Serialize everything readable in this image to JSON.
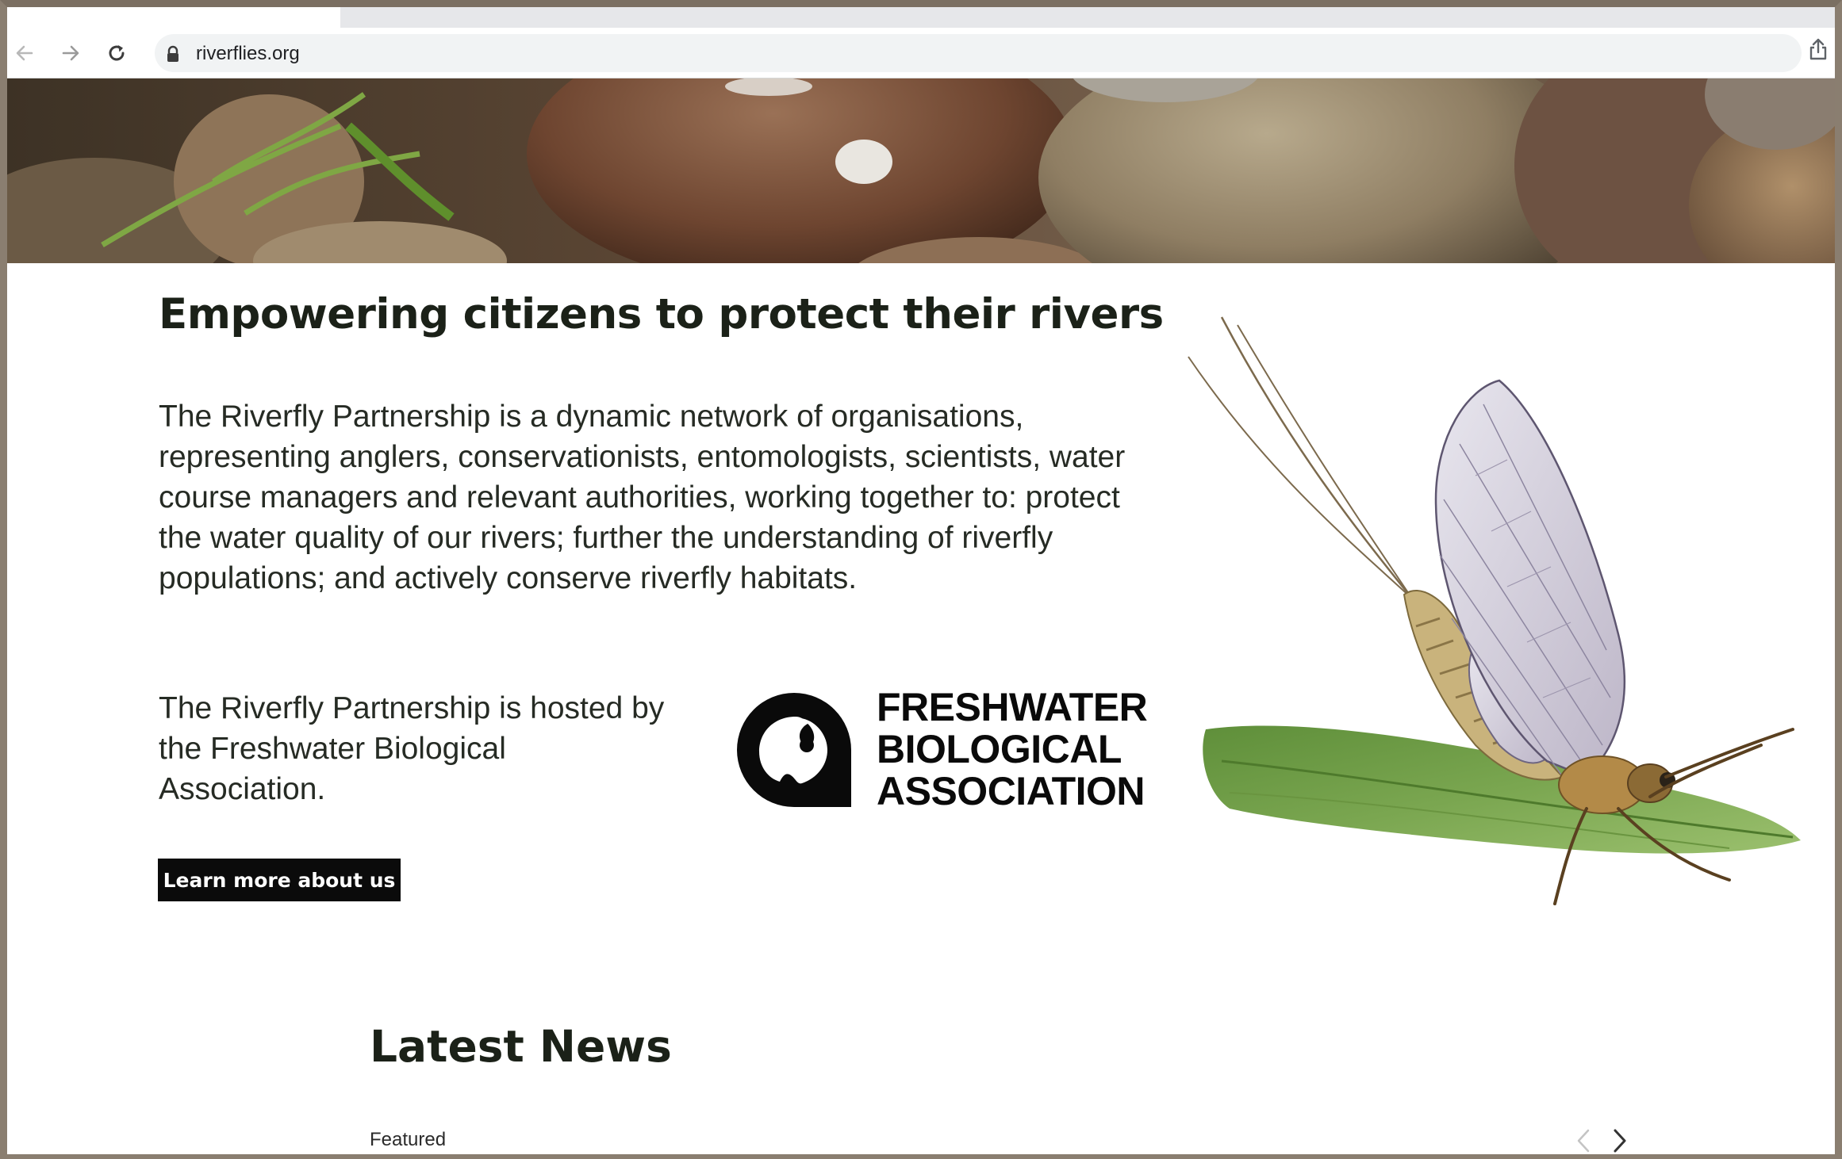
{
  "browser": {
    "url": "riverflies.org",
    "icons": {
      "back": "arrow-left-icon",
      "forward": "arrow-right-icon",
      "reload": "reload-icon",
      "lock": "lock-icon",
      "share": "share-icon"
    }
  },
  "hero": {
    "headline": "Empowering citizens to protect their rivers",
    "intro": "The Riverfly Partnership is a dynamic network of organisations, representing anglers, conservationists, entomologists, scientists, water course managers and relevant authorities, working together to: protect the water quality of our rivers; further the understanding of riverfly populations; and actively conserve riverfly habitats.",
    "hosted": "The Riverfly Partnership is hosted by the Freshwater Biological Association.",
    "cta_label": "Learn more about us"
  },
  "partner_logo": {
    "line1": "FRESHWATER",
    "line2": "BIOLOGICAL",
    "line3": "ASSOCIATION"
  },
  "news": {
    "title": "Latest News",
    "category": "Featured",
    "icons": {
      "prev": "chevron-left-icon",
      "next": "chevron-right-icon"
    }
  },
  "colors": {
    "text": "#1b2118",
    "button_bg": "#0b0b0b",
    "button_text": "#ffffff",
    "chrome_bg": "#f1f3f4"
  }
}
